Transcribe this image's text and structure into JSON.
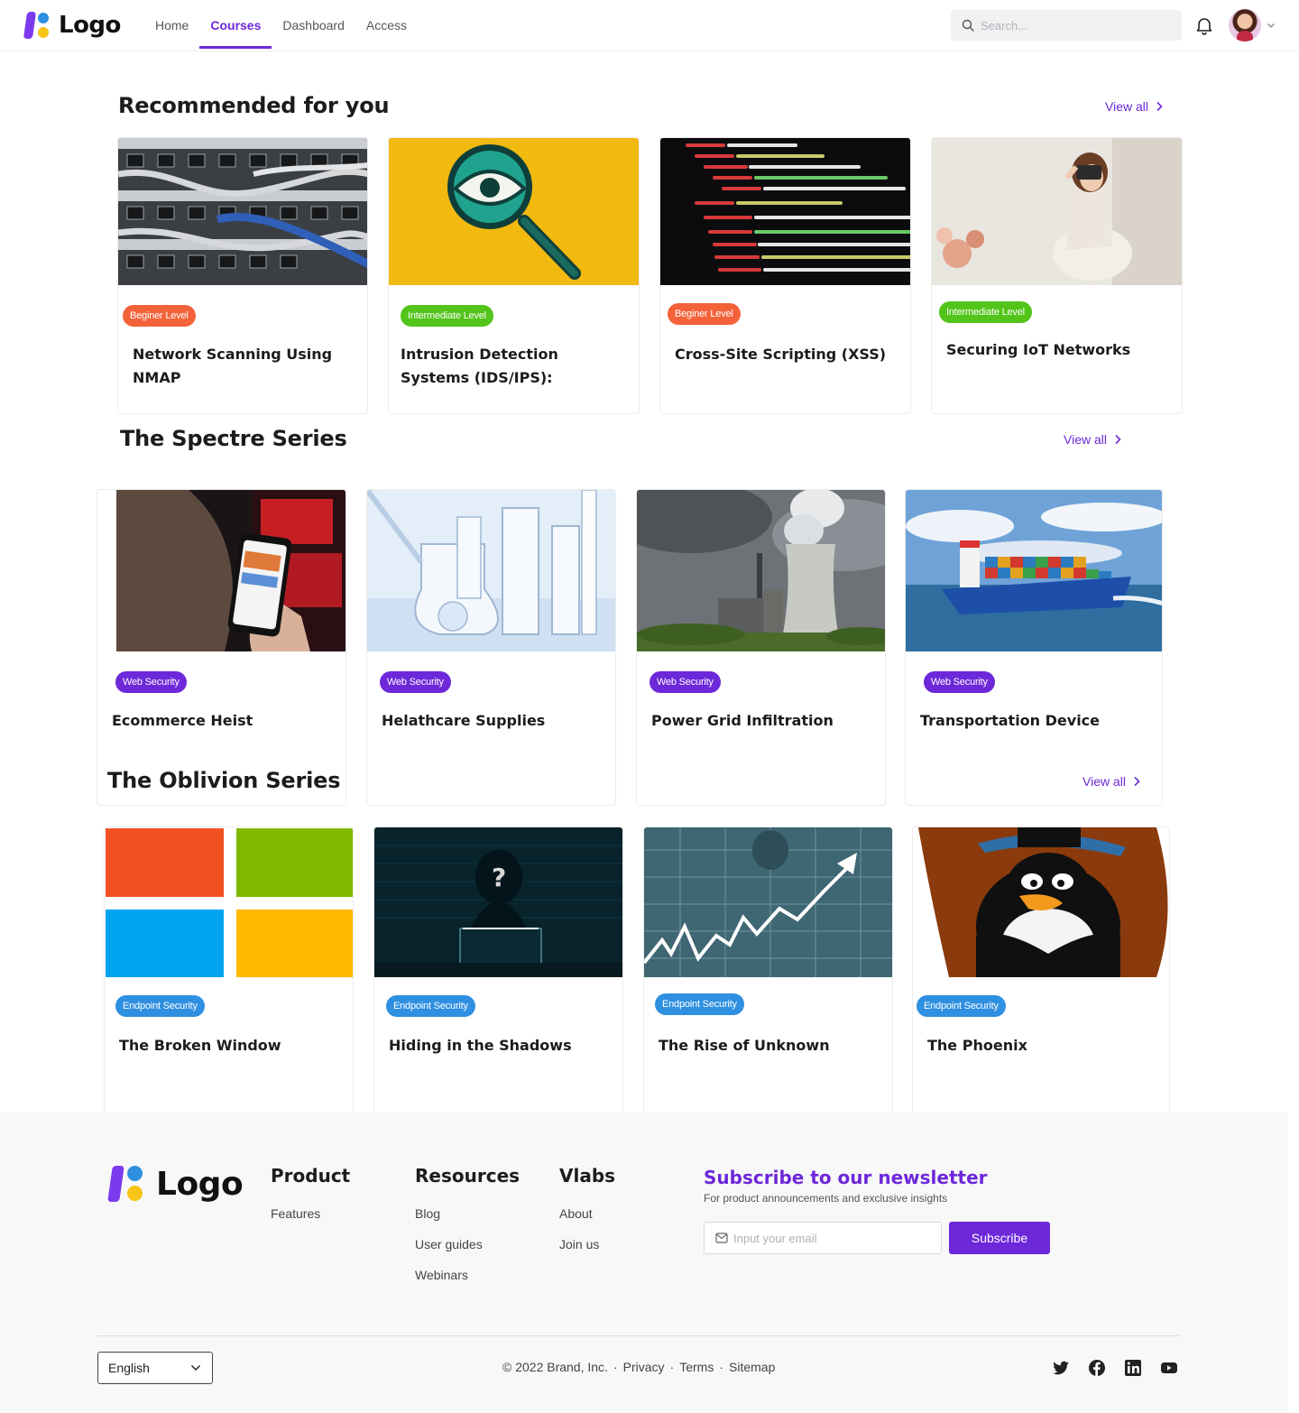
{
  "header": {
    "logo_text": "Logo",
    "nav": [
      {
        "label": "Home",
        "active": false
      },
      {
        "label": "Courses",
        "active": true
      },
      {
        "label": "Dashboard",
        "active": false
      },
      {
        "label": "Access",
        "active": false
      }
    ],
    "search_placeholder": "Search..."
  },
  "sections": {
    "recommended": {
      "title": "Recommended for you",
      "view_all": "View all",
      "cards": [
        {
          "badge": "Beginer Level",
          "title": "Network Scanning Using NMAP"
        },
        {
          "badge": "Intermediate Level",
          "title": "Intrusion Detection Systems (IDS/IPS):"
        },
        {
          "badge": "Beginer Level",
          "title": "Cross-Site Scripting (XSS)"
        },
        {
          "badge": "Intermediate Level",
          "title": "Securing IoT Networks"
        }
      ]
    },
    "spectre": {
      "title": "The Spectre Series",
      "view_all": "View all",
      "cards": [
        {
          "badge": "Web Security",
          "title": "Ecommerce Heist"
        },
        {
          "badge": "Web Security",
          "title": "Helathcare Supplies"
        },
        {
          "badge": "Web Security",
          "title": "Power Grid Infiltration"
        },
        {
          "badge": "Web Security",
          "title": "Transportation Device"
        }
      ]
    },
    "oblivion": {
      "title": "The Oblivion Series",
      "view_all": "View all",
      "cards": [
        {
          "badge": "Endpoint Security",
          "title": "The Broken Window"
        },
        {
          "badge": "Endpoint Security",
          "title": "Hiding in the Shadows"
        },
        {
          "badge": "Endpoint Security",
          "title": "The Rise of Unknown"
        },
        {
          "badge": "Endpoint Security",
          "title": "The Phoenix"
        }
      ]
    }
  },
  "colors": {
    "accent": "#6d28d9",
    "beginner": "#f4623a",
    "intermediate": "#52c41a",
    "web_security": "#6d28d9",
    "endpoint_security": "#2f8fe0"
  },
  "footer": {
    "logo_text": "Logo",
    "columns": [
      {
        "title": "Product",
        "links": [
          "Features"
        ]
      },
      {
        "title": "Resources",
        "links": [
          "Blog",
          "User guides",
          "Webinars"
        ]
      },
      {
        "title": "Vlabs",
        "links": [
          "About",
          "Join us"
        ]
      }
    ],
    "newsletter": {
      "title": "Subscribe to our newsletter",
      "subtitle": "For product announcements and exclusive insights",
      "placeholder": "Input your email",
      "button": "Subscribe"
    },
    "language": "English",
    "copyright": "© 2022 Brand, Inc.",
    "legal": [
      "Privacy",
      "Terms",
      "Sitemap"
    ],
    "socials": [
      "twitter-icon",
      "facebook-icon",
      "linkedin-icon",
      "youtube-icon"
    ]
  }
}
